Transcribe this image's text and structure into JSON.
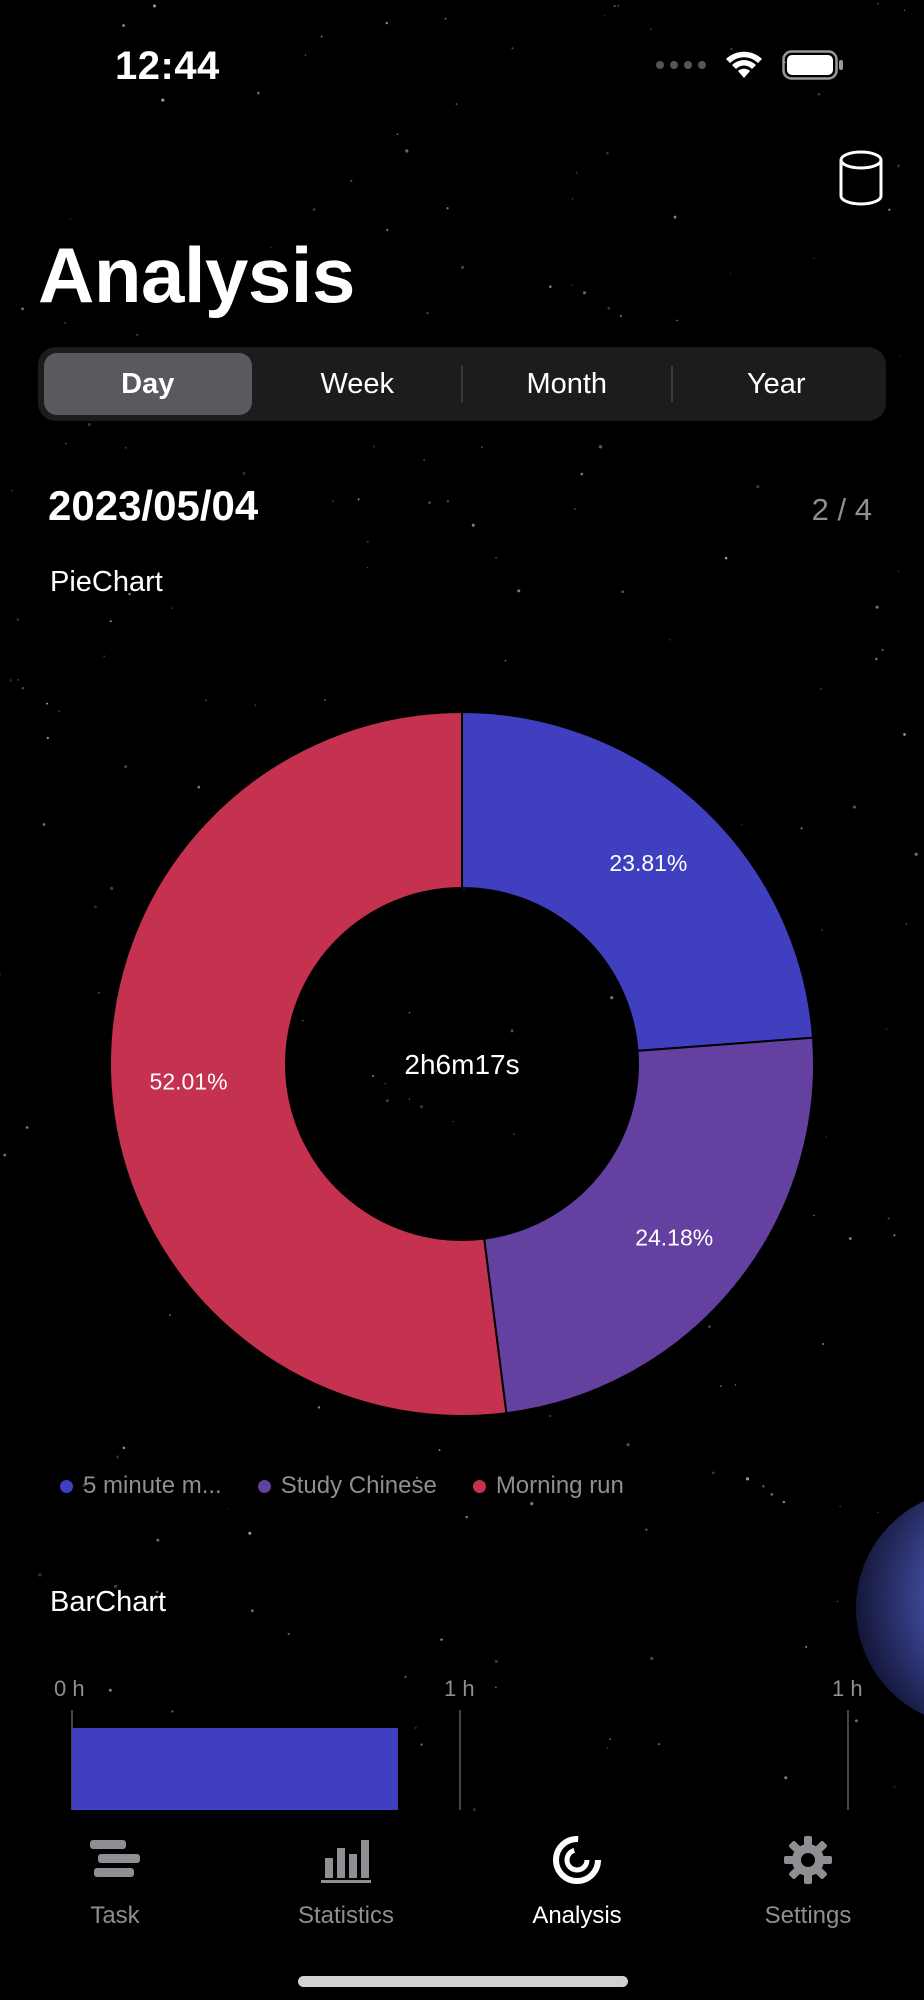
{
  "status_bar": {
    "time": "12:44"
  },
  "header": {
    "title": "Analysis",
    "icon": "database-icon"
  },
  "segments": [
    {
      "label": "Day",
      "selected": true
    },
    {
      "label": "Week",
      "selected": false
    },
    {
      "label": "Month",
      "selected": false
    },
    {
      "label": "Year",
      "selected": false
    }
  ],
  "period": {
    "date": "2023/05/04",
    "counter": "2 / 4"
  },
  "pie_section": {
    "title": "PieChart",
    "center_label": "2h6m17s"
  },
  "bar_section": {
    "title": "BarChart"
  },
  "legend": [
    {
      "label": "5 minute m...",
      "color": "#3f3fbf"
    },
    {
      "label": "Study Chinese",
      "color": "#6440a0"
    },
    {
      "label": "Morning run",
      "color": "#c43250"
    }
  ],
  "chart_data": [
    {
      "type": "pie",
      "variant": "donut",
      "center_text": "2h6m17s",
      "series": [
        {
          "name": "5 minute m...",
          "value": 23.81,
          "label": "23.81%",
          "color": "#3f3fbf"
        },
        {
          "name": "Study Chinese",
          "value": 24.18,
          "label": "24.18%",
          "color": "#6440a0"
        },
        {
          "name": "Morning run",
          "value": 52.01,
          "label": "52.01%",
          "color": "#c43250"
        }
      ]
    },
    {
      "type": "bar",
      "orientation": "horizontal",
      "tick_labels": [
        "0 h",
        "1 h",
        "1 h"
      ],
      "series": [
        {
          "name": "5 minute m...",
          "fraction_of_first_tick_span": 0.84,
          "color": "#3f3fbf"
        }
      ]
    }
  ],
  "tabs": [
    {
      "label": "Task",
      "icon": "task-stack-icon",
      "active": false
    },
    {
      "label": "Statistics",
      "icon": "bar-chart-icon",
      "active": false
    },
    {
      "label": "Analysis",
      "icon": "analysis-ring-icon",
      "active": true
    },
    {
      "label": "Settings",
      "icon": "gear-icon",
      "active": false
    }
  ]
}
